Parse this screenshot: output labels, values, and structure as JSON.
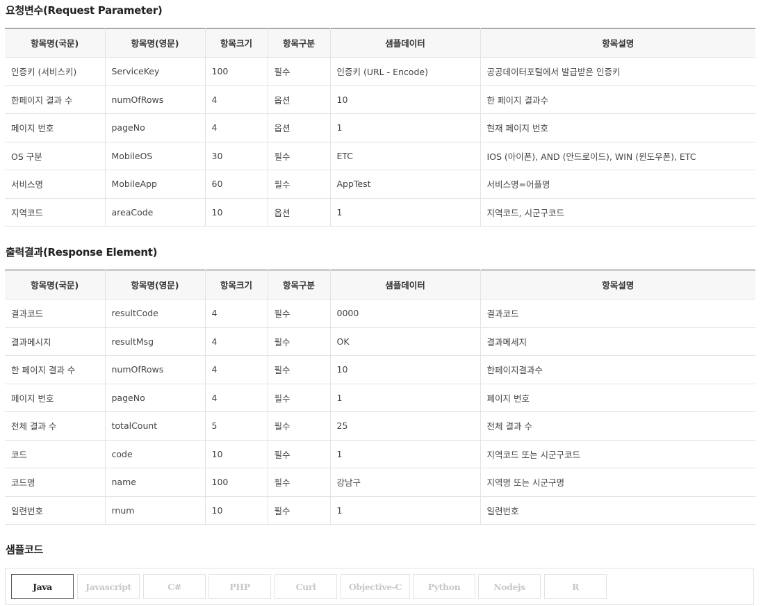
{
  "request": {
    "title": "요청변수(Request Parameter)",
    "headers": [
      "항목명(국문)",
      "항목명(영문)",
      "항목크기",
      "항목구분",
      "샘플데이터",
      "항목설명"
    ],
    "rows": [
      [
        "인증키 (서비스키)",
        "ServiceKey",
        "100",
        "필수",
        "인증키 (URL - Encode)",
        "공공데이터포털에서 발급받은 인증키"
      ],
      [
        "한페이지 결과 수",
        "numOfRows",
        "4",
        "옵션",
        "10",
        "한 페이지 결과수"
      ],
      [
        "페이지 번호",
        "pageNo",
        "4",
        "옵션",
        "1",
        "현재 페이지 번호"
      ],
      [
        "OS 구분",
        "MobileOS",
        "30",
        "필수",
        "ETC",
        "IOS (아이폰), AND (안드로이드), WIN (윈도우폰), ETC"
      ],
      [
        "서비스명",
        "MobileApp",
        "60",
        "필수",
        "AppTest",
        "서비스명=어플명"
      ],
      [
        "지역코드",
        "areaCode",
        "10",
        "옵션",
        "1",
        "지역코드, 시군구코드"
      ]
    ]
  },
  "response": {
    "title": "출력결과(Response Element)",
    "headers": [
      "항목명(국문)",
      "항목명(영문)",
      "항목크기",
      "항목구분",
      "샘플데이터",
      "항목설명"
    ],
    "rows": [
      [
        "결과코드",
        "resultCode",
        "4",
        "필수",
        "0000",
        "결과코드"
      ],
      [
        "결과메시지",
        "resultMsg",
        "4",
        "필수",
        "OK",
        "결과메세지"
      ],
      [
        "한 페이지 결과 수",
        "numOfRows",
        "4",
        "필수",
        "10",
        "한페이지결과수"
      ],
      [
        "페이지 번호",
        "pageNo",
        "4",
        "필수",
        "1",
        "페이지 번호"
      ],
      [
        "전체 결과 수",
        "totalCount",
        "5",
        "필수",
        "25",
        "전체 결과 수"
      ],
      [
        "코드",
        "code",
        "10",
        "필수",
        "1",
        "지역코드 또는 시군구코드"
      ],
      [
        "코드명",
        "name",
        "100",
        "필수",
        "강남구",
        "지역명 또는 시군구명"
      ],
      [
        "일련번호",
        "rnum",
        "10",
        "필수",
        "1",
        "일련번호"
      ]
    ]
  },
  "sample": {
    "title": "샘플코드",
    "active_tab": "Java",
    "tabs": [
      "Java",
      "Javascript",
      "C#",
      "PHP",
      "Curl",
      "Objective-C",
      "Python",
      "Nodejs",
      "R"
    ]
  }
}
